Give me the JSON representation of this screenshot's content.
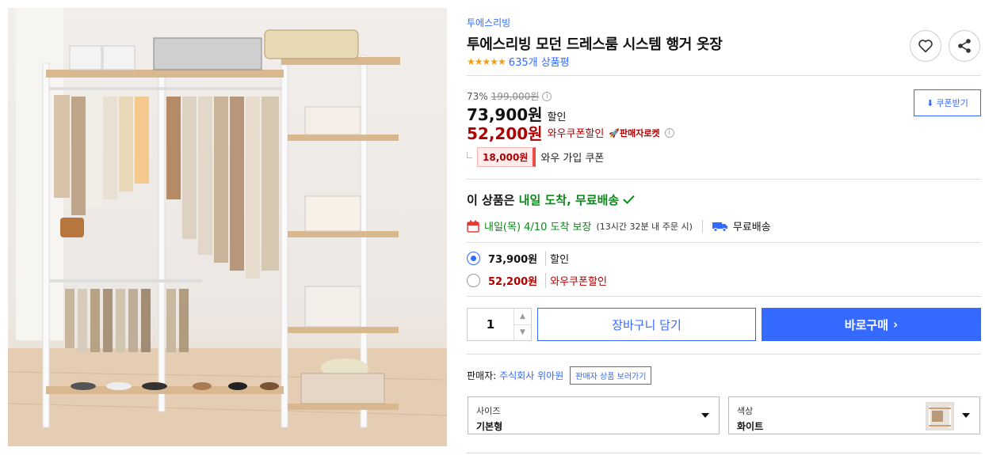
{
  "product": {
    "brand": "투에스리빙",
    "title": "투에스리빙 모던 드레스룸 시스템 행거 옷장",
    "stars": "★★★★★",
    "review_count": "635개 상품평"
  },
  "price": {
    "discount_rate": "73%",
    "original_price": "199,000원",
    "sale_price": "73,900원",
    "sale_label": "할인",
    "wow_price": "52,200원",
    "wow_label": "와우쿠폰할인",
    "rocket_badge": "판매자로켓",
    "join_coupon": "18,000원",
    "join_text": "와우 가입 쿠폰",
    "coupon_button": "쿠폰받기"
  },
  "delivery": {
    "headline_prefix": "이 상품은 ",
    "headline_highlight": "내일 도착, 무료배송",
    "arrival": "내일(목) 4/10 도착 보장",
    "order_note": "(13시간 32분 내 주문 시)",
    "free_shipping": "무료배송"
  },
  "options": [
    {
      "price": "73,900원",
      "label": "할인",
      "selected": true
    },
    {
      "price": "52,200원",
      "label": "와우쿠폰할인",
      "selected": false
    }
  ],
  "purchase": {
    "quantity": "1",
    "cart_button": "장바구니 담기",
    "buy_button": "바로구매"
  },
  "seller": {
    "prefix": "판매자:",
    "name": "주식회사 위아원",
    "link": "판매자 상품 보러가기"
  },
  "selects": {
    "size_label": "사이즈",
    "size_value": "기본형",
    "color_label": "색상",
    "color_value": "화이트"
  },
  "colors": {
    "accent": "#346aff",
    "wow_red": "#ae0000",
    "delivery_green": "#0b8a1b",
    "star": "#f79c0e"
  },
  "icons": [
    "heart-icon",
    "share-icon",
    "info-icon",
    "download-icon",
    "rocket-icon",
    "calendar-icon",
    "truck-icon",
    "checkmark-icon",
    "chevron-right-icon",
    "caret-down-icon"
  ]
}
